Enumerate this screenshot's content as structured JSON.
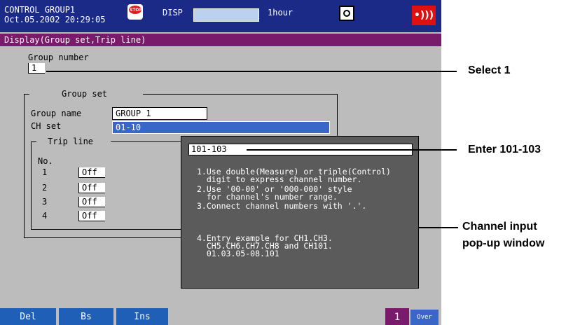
{
  "status_bar": {
    "group": "CONTROL GROUP1",
    "datetime": "Oct.05.2002 20:29:05",
    "stop_icon_text": "STOP",
    "mode": "DISP",
    "time_span": "1hour",
    "alarm_icon": "•)))"
  },
  "window_title": "Display(Group set,Trip line)",
  "group_number": {
    "label": "Group number",
    "value": "1"
  },
  "group_set": {
    "title": "Group set",
    "name_label": "Group name",
    "name_value": "GROUP 1",
    "ch_label": "CH set",
    "ch_value": "01-10"
  },
  "trip_line": {
    "title": "Trip line",
    "no_label": "No.",
    "rows": [
      {
        "no": "1",
        "value": "Off"
      },
      {
        "no": "2",
        "value": "Off"
      },
      {
        "no": "3",
        "value": "Off"
      },
      {
        "no": "4",
        "value": "Off"
      }
    ]
  },
  "popup": {
    "input_value": "101-103",
    "help1": "1.Use double(Measure) or triple(Control)\n  digit to express channel number.",
    "help2": "2.Use '00-00' or '000-000' style\n  for channel's number range.",
    "help3": "3.Connect channel numbers with '.'.",
    "help4": "4.Entry example for CH1.CH3.\n  CH5.CH6.CH7.CH8 and CH101.\n  01.03.05-08.101"
  },
  "softkeys": {
    "del": "Del",
    "bs": "Bs",
    "ins": "Ins"
  },
  "page_indicator": "1",
  "over_indicator": "Over",
  "callouts": {
    "select": "Select 1",
    "enter": "Enter 101-103",
    "popup_line1": "Channel input",
    "popup_line2": "pop-up window"
  },
  "colors": {
    "header_bg": "#1a2a86",
    "title_bg": "#7a1a6a",
    "screen_bg": "#bcbcbc",
    "popup_bg": "#5b5b5b",
    "softkey_bg": "#1f5fb8",
    "selection": "#3a66c8"
  }
}
